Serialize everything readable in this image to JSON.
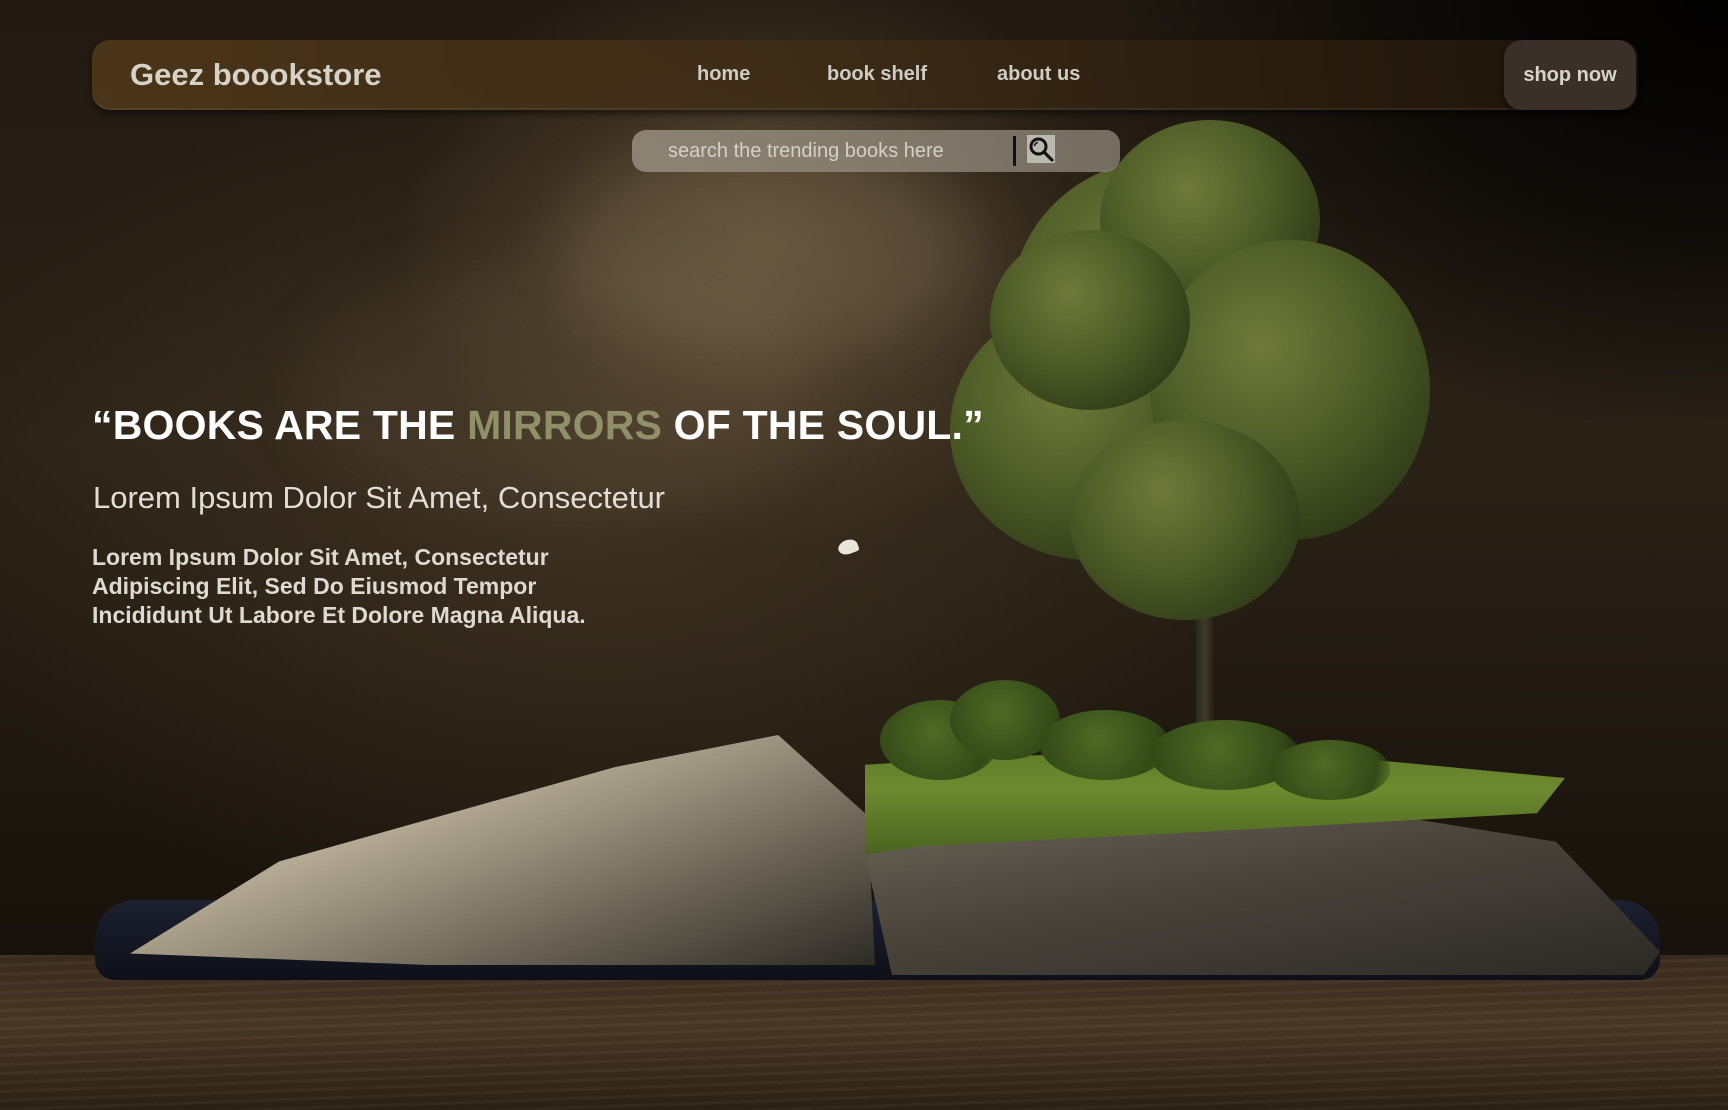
{
  "navbar": {
    "brand": "Geez boookstore",
    "links": [
      {
        "label": "home"
      },
      {
        "label": "book shelf"
      },
      {
        "label": "about us"
      }
    ],
    "cta_label": "shop now"
  },
  "search": {
    "placeholder": "search the trending books here",
    "icon": "search-icon"
  },
  "hero": {
    "quote_open": "“BOOKS ARE THE ",
    "quote_accent": "MIRRORS",
    "quote_close": " OF THE SOUL.”",
    "subtitle": "Lorem Ipsum Dolor Sit Amet, Consectetur",
    "body": "Lorem Ipsum Dolor Sit Amet, Consectetur Adipiscing Elit, Sed Do Eiusmod Tempor Incididunt Ut Labore Et Dolore Magna Aliqua."
  },
  "colors": {
    "accent": "#8f9068",
    "navbar": "#4e3719",
    "button": "#3a3029"
  }
}
